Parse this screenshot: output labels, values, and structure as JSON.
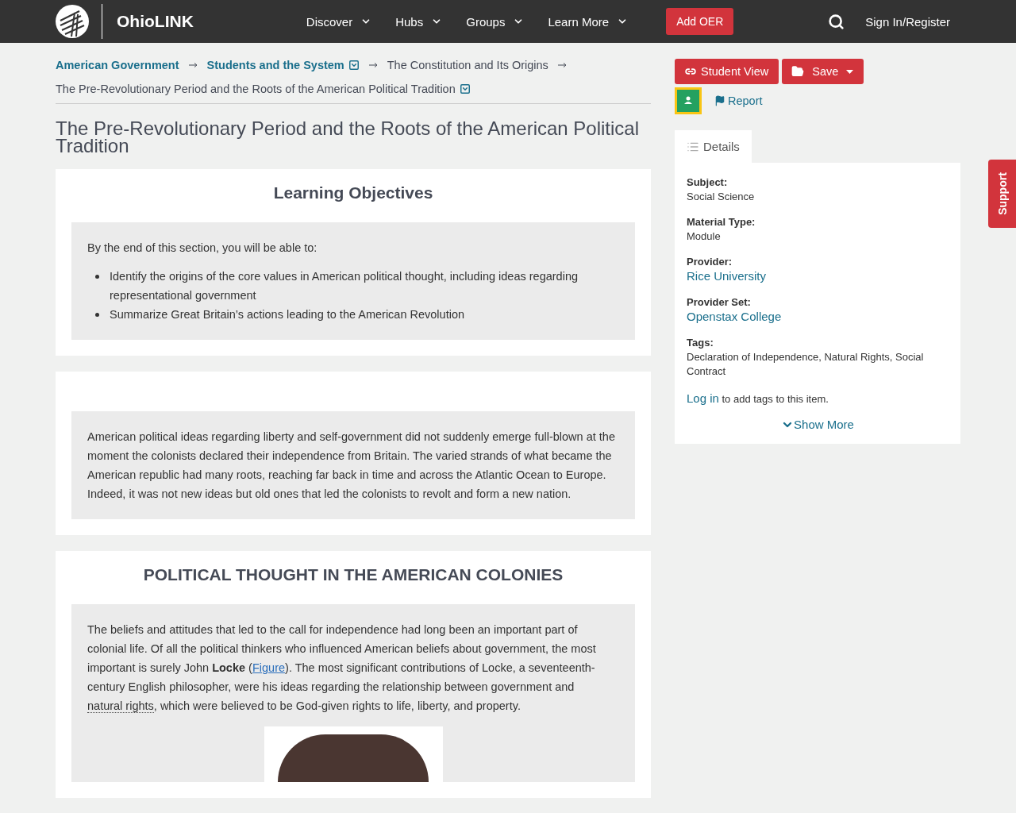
{
  "header": {
    "brand": "OhioLINK",
    "nav": [
      {
        "label": "Discover"
      },
      {
        "label": "Hubs"
      },
      {
        "label": "Groups"
      },
      {
        "label": "Learn More"
      }
    ],
    "add_button": "Add OER",
    "sign_in": "Sign In/Register"
  },
  "breadcrumbs": [
    {
      "label": "American Government",
      "kind": "link",
      "dropdown": false
    },
    {
      "label": "Students and the System",
      "kind": "link",
      "dropdown": true
    },
    {
      "label": "The Constitution and Its Origins",
      "kind": "text",
      "dropdown": false
    },
    {
      "label": "The Pre-Revolutionary Period and the Roots of the American Political Tradition",
      "kind": "text",
      "dropdown": true
    }
  ],
  "title": "The Pre-Revolutionary Period and the Roots of the American Political Tradition",
  "objectives": {
    "heading": "Learning Objectives",
    "intro": "By the end of this section, you will be able to:",
    "items": [
      "Identify the origins of the core values in American political thought, including ideas regarding representational government",
      "Summarize Great Britain’s actions leading to the American Revolution"
    ]
  },
  "intro_paragraph": "American political ideas regarding liberty and self-government did not suddenly emerge full-blown at the moment the colonists declared their independence from Britain. The varied strands of what became the American republic had many roots, reaching far back in time and across the Atlantic Ocean to Europe. Indeed, it was not new ideas but old ones that led the colonists to revolt and form a new nation.",
  "section": {
    "heading": "POLITICAL THOUGHT IN THE AMERICAN COLONIES",
    "text_start": "The beliefs and attitudes that led to the call for independence had long been an important part of colonial life. Of all the political thinkers who influenced American beliefs about government, the most important is surely John **Locke** (",
    "link": "Figure",
    "text_middle": "). The most significant contributions of Locke, a seventeenth-century English philosopher, were his ideas regarding the relationship between government and ",
    "term": "natural rights",
    "text_end": ", which were believed to be God-given rights to life, liberty, and property."
  },
  "actions": {
    "student_view": "Student View",
    "save": "Save",
    "report": "Report"
  },
  "details": {
    "tab": "Details",
    "fields": [
      {
        "label": "Subject:",
        "value": "Social Science",
        "kind": "text"
      },
      {
        "label": "Material Type:",
        "value": "Module",
        "kind": "text"
      },
      {
        "label": "Provider:",
        "value": "Rice University",
        "kind": "link"
      },
      {
        "label": "Provider Set:",
        "value": "Openstax College",
        "kind": "link"
      },
      {
        "label": "Tags:",
        "value": "Declaration of Independence, Natural Rights, Social Contract",
        "kind": "text"
      }
    ],
    "login_link": "Log in",
    "login_text": "to add tags to this item.",
    "show_more": "Show More"
  },
  "support": "Support"
}
